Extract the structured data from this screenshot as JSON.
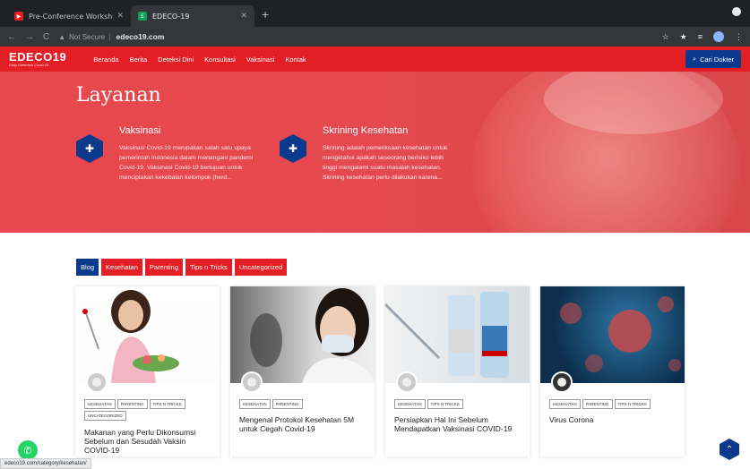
{
  "browser": {
    "tabs": [
      {
        "label": "Pre-Conference Workshop Pe",
        "favicon_color": "#e31e24"
      },
      {
        "label": "EDECO-19",
        "favicon_color": "#0f9d58",
        "active": true
      }
    ],
    "address": {
      "security": "Not Secure",
      "url": "edeco19.com"
    }
  },
  "site": {
    "logo": "EDECO19",
    "logo_tagline": "Early Detection Covid-19",
    "menu": [
      "Beranda",
      "Berita",
      "Deteksi Dini",
      "Konsultasi",
      "Vaksinasi",
      "Kontak"
    ],
    "cta": "Cari Dokter"
  },
  "hero": {
    "title": "Layanan",
    "services": [
      {
        "title": "Vaksinasi",
        "desc": "Vaksinasi Covid-19 merupakan salah satu upaya pemerintah Indonesia dalam menangani pandemi Covid-19. Vaksinasi Covid-19 bertujuan untuk menciptakan kekebalan kelompok (herd..."
      },
      {
        "title": "Skrining Kesehatan",
        "desc": "Skrining adalah pemeriksaan kesehatan untuk mengetahui apakah seseorang berisiko lebih tinggi mengalami suatu masalah kesehatan. Skrining kesehatan perlu dilakukan karena..."
      }
    ]
  },
  "filters": [
    "Blog",
    "Kesehatan",
    "Parenting",
    "Tips n Tricks",
    "Uncategorized"
  ],
  "cards": [
    {
      "tags": [
        "KESEHATAN",
        "PARENTING",
        "TIPS N TRICKS",
        "UNCATEGORIZED"
      ],
      "title": "Makanan yang Perlu Dikonsumsi Sebelum dan Sesudah Vaksin COVID-19"
    },
    {
      "tags": [
        "KESEHATAN",
        "PARENTING"
      ],
      "title": "Mengenal Protokol Kesehatan 5M untuk Cegah Covid-19"
    },
    {
      "tags": [
        "KESEHATAN",
        "TIPS N TRICKS"
      ],
      "title": "Persiapkan Hal Ini Sebelum Mendapatkan Vaksinasi COVID-19"
    },
    {
      "tags": [
        "KESEHATAN",
        "PARENTING",
        "TIPS N TRICKS"
      ],
      "title": "Virus Corona"
    }
  ],
  "statusbar": "edeco19.com/category/kesehatan/",
  "colors": {
    "brand_red": "#e31e24",
    "brand_blue": "#0b3a8c"
  }
}
